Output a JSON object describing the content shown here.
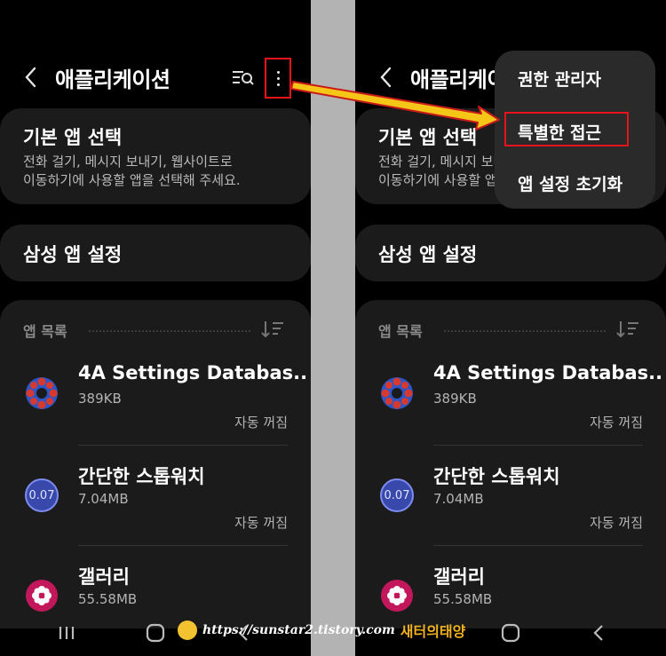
{
  "header": {
    "title": "애플리케이션"
  },
  "default_apps": {
    "title": "기본 앱 선택",
    "desc_line1": "전화 걸기, 메시지 보내기, 웹사이트로",
    "desc_line2": "이동하기에 사용할 앱을 선택해 주세요."
  },
  "samsung_settings": {
    "title": "삼성 앱 설정"
  },
  "app_list": {
    "label": "앱 목록",
    "items": [
      {
        "name": "4A Settings Databas..",
        "size": "389KB",
        "status": "자동 꺼짐"
      },
      {
        "name": "간단한 스톱워치",
        "size": "7.04MB",
        "status": "자동 꺼짐",
        "icon_text": "0.07"
      },
      {
        "name": "갤러리",
        "size": "55.58MB"
      }
    ]
  },
  "menu": {
    "items": [
      "권한 관리자",
      "특별한 접근",
      "앱 설정 초기화"
    ]
  },
  "watermark": {
    "url": "https://sunstar2.tistory.com",
    "brand": "새터의태양"
  },
  "colors": {
    "highlight": "#e8141b",
    "card_bg": "#1b1b1b",
    "menu_bg": "#2a2a2a",
    "divider_gray": "#b3b3b3"
  },
  "icons": [
    "back-icon",
    "search-list-icon",
    "more-options-icon",
    "sort-icon",
    "recents-icon",
    "home-icon",
    "nav-back-icon"
  ]
}
